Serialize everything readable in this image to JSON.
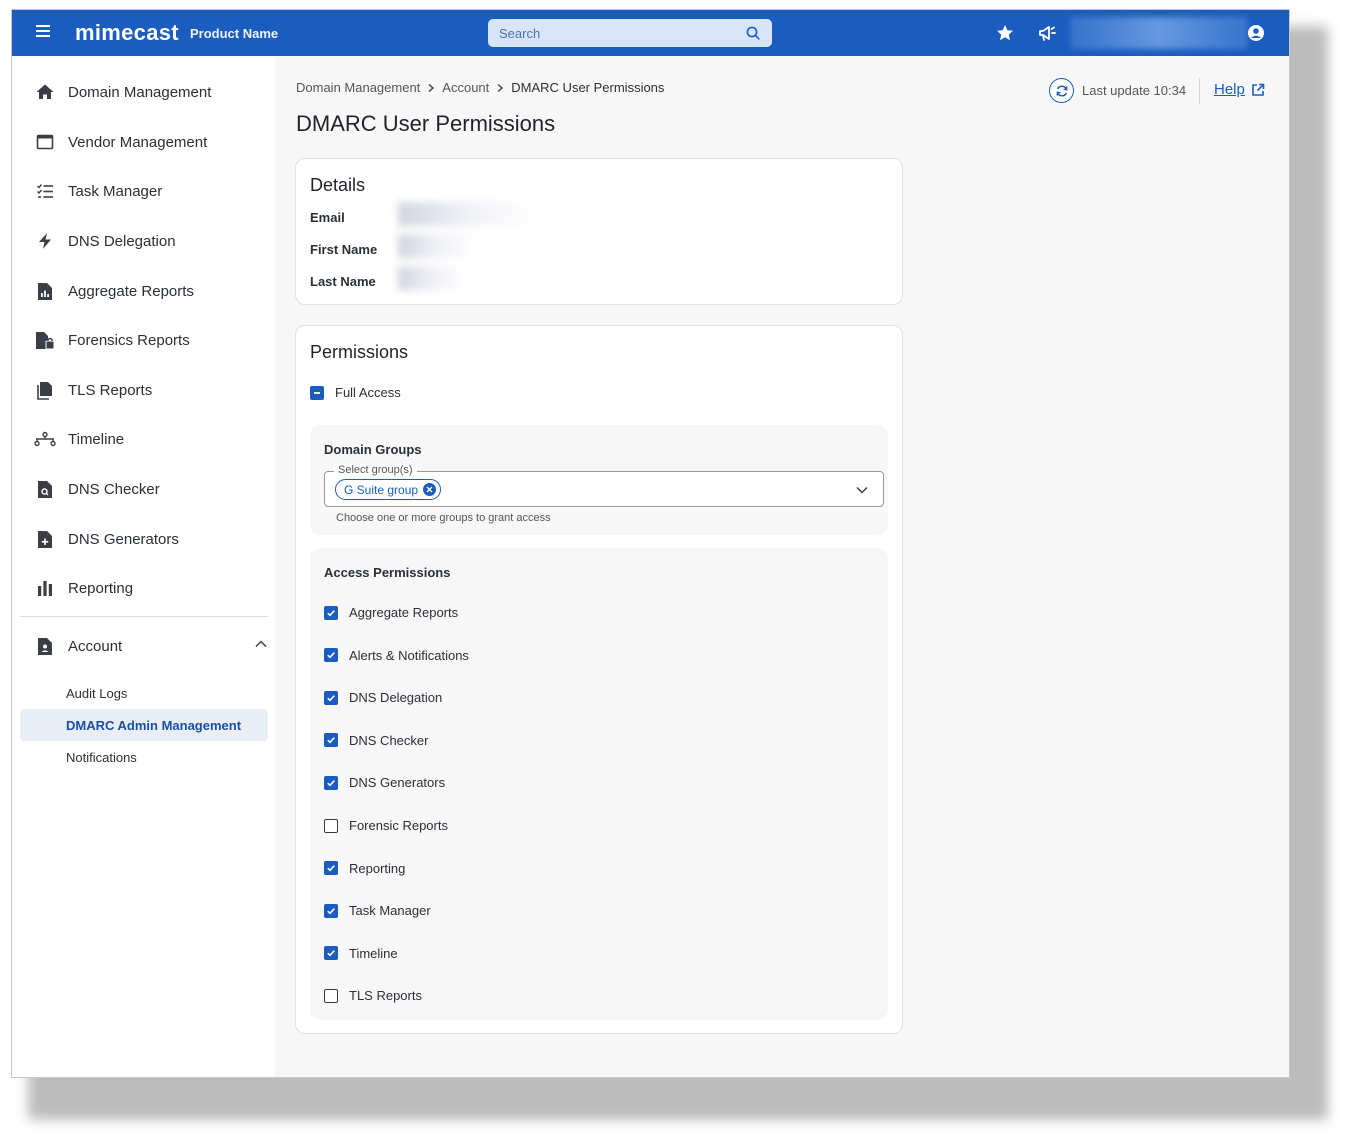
{
  "header": {
    "logo": "mimecast",
    "product_name": "Product Name",
    "search_placeholder": "Search"
  },
  "sidebar": {
    "items": [
      {
        "label": "Domain Management",
        "icon": "home-icon"
      },
      {
        "label": "Vendor Management",
        "icon": "window-icon"
      },
      {
        "label": "Task Manager",
        "icon": "checklist-icon"
      },
      {
        "label": "DNS Delegation",
        "icon": "bolt-icon"
      },
      {
        "label": "Aggregate Reports",
        "icon": "report-chart-icon"
      },
      {
        "label": "Forensics Reports",
        "icon": "forensic-file-icon"
      },
      {
        "label": "TLS Reports",
        "icon": "files-icon"
      },
      {
        "label": "Timeline",
        "icon": "timeline-icon"
      },
      {
        "label": "DNS Checker",
        "icon": "file-search-icon"
      },
      {
        "label": "DNS Generators",
        "icon": "file-plus-icon"
      },
      {
        "label": "Reporting",
        "icon": "bar-chart-icon"
      }
    ],
    "account": {
      "label": "Account",
      "icon": "account-file-icon",
      "sub_items": [
        {
          "label": "Audit Logs",
          "active": false
        },
        {
          "label": "DMARC Admin Management",
          "active": true
        },
        {
          "label": "Notifications",
          "active": false
        }
      ]
    }
  },
  "breadcrumb": [
    "Domain Management",
    "Account",
    "DMARC User Permissions"
  ],
  "last_update": "Last update 10:34",
  "help_label": "Help",
  "page_title": "DMARC User Permissions",
  "details": {
    "title": "Details",
    "fields": [
      "Email",
      "First Name",
      "Last Name"
    ]
  },
  "permissions": {
    "title": "Permissions",
    "full_access_label": "Full Access",
    "full_access_state": "indeterminate",
    "domain_groups": {
      "title": "Domain Groups",
      "select_label": "Select group(s)",
      "selected": [
        "G Suite group"
      ],
      "helper": "Choose one or more groups to grant access"
    },
    "access": {
      "title": "Access Permissions",
      "items": [
        {
          "label": "Aggregate Reports",
          "checked": true
        },
        {
          "label": "Alerts & Notifications",
          "checked": true
        },
        {
          "label": "DNS Delegation",
          "checked": true
        },
        {
          "label": "DNS Checker",
          "checked": true
        },
        {
          "label": "DNS Generators",
          "checked": true
        },
        {
          "label": "Forensic Reports",
          "checked": false
        },
        {
          "label": "Reporting",
          "checked": true
        },
        {
          "label": "Task Manager",
          "checked": true
        },
        {
          "label": "Timeline",
          "checked": true
        },
        {
          "label": "TLS Reports",
          "checked": false
        }
      ]
    }
  },
  "colors": {
    "brand": "#1b5dbf",
    "active_bg": "#e9eef6",
    "page_bg": "#f7f7f7"
  }
}
